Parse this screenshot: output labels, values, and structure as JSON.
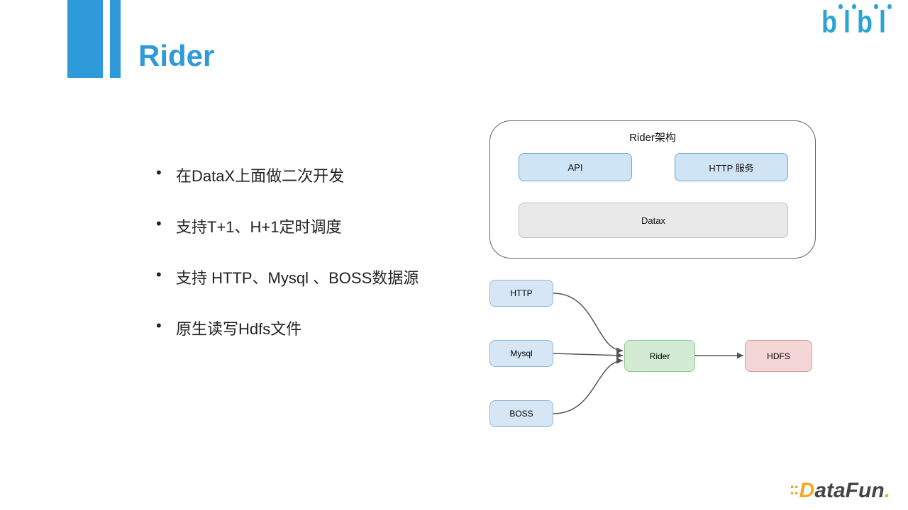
{
  "title": "Rider",
  "logo_top": "bilibili",
  "bullets": [
    "在DataX上面做二次开发",
    "支持T+1、H+1定时调度",
    "支持 HTTP、Mysql 、BOSS数据源",
    "原生读写Hdfs文件"
  ],
  "arch": {
    "title": "Rider架构",
    "api": "API",
    "http": "HTTP 服务",
    "datax": "Datax"
  },
  "flow": {
    "http": "HTTP",
    "mysql": "Mysql",
    "boss": "BOSS",
    "rider": "Rider",
    "hdfs": "HDFS"
  },
  "logo_bottom": "DataFun."
}
